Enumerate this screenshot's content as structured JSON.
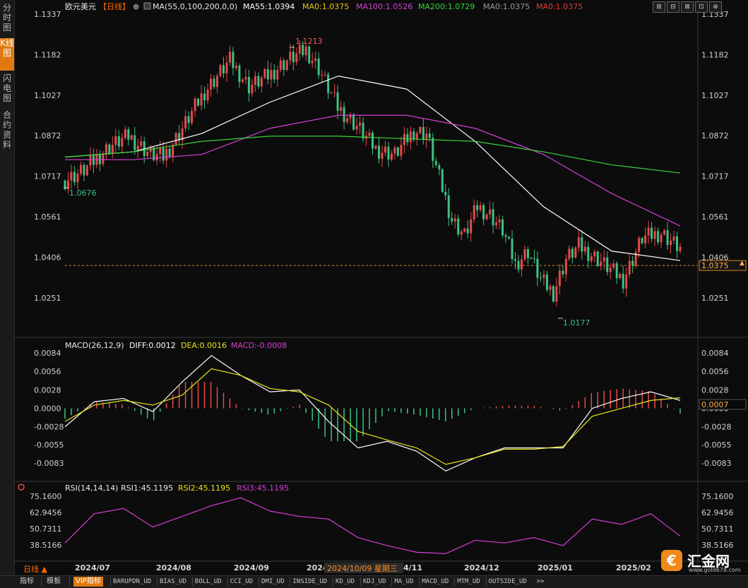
{
  "sidebar": {
    "tabs": [
      {
        "label": "分时图",
        "active": false
      },
      {
        "label": "K线图",
        "active": true
      },
      {
        "label": "闪电图",
        "active": false
      },
      {
        "label": "合约资料",
        "active": false
      }
    ]
  },
  "header": {
    "symbol": "欧元美元",
    "period_tag": "【日线】",
    "add_icon": "⊕",
    "ma_icon": "chart-settings-icon",
    "ma_params": "MA(55,0,100,200,0,0)",
    "items": [
      {
        "text": "MA55:1.0394",
        "color": "#ffffff"
      },
      {
        "text": "MA0:1.0375",
        "color": "#e6c619"
      },
      {
        "text": "MA100:1.0526",
        "color": "#d63ed6"
      },
      {
        "text": "MA200:1.0729",
        "color": "#3ad13a"
      },
      {
        "text": "MA0:1.0375",
        "color": "#9a9a9a"
      },
      {
        "text": "MA0:1.0375",
        "color": "#e03b3b"
      }
    ]
  },
  "window_buttons": [
    "⊞",
    "⊟",
    "⊠",
    "⊡",
    "⊗"
  ],
  "colors": {
    "up": "#e64a4a",
    "down": "#3cc285",
    "ma55": "#ffffff",
    "ma100": "#d63ed6",
    "ma200": "#3ad13a",
    "dea": "#e6e619",
    "rsi": "#d63ed6",
    "price_line": "#d98b1e"
  },
  "price_axis": {
    "ticks": [
      "1.1337",
      "1.1182",
      "1.1027",
      "1.0872",
      "1.0717",
      "1.0561",
      "1.0406",
      "1.0251"
    ],
    "current": "1.0375"
  },
  "annotations": {
    "high": "1.1213",
    "low_left": "1.0676",
    "low_right": "1.0177"
  },
  "macd": {
    "title": "MACD(26,12,9)",
    "diff": "DIFF:0.0012",
    "dea": "DEA:0.0016",
    "macd": "MACD:-0.0008",
    "ticks": [
      "0.0084",
      "0.0056",
      "0.0028",
      "0.0000",
      "-0.0028",
      "-0.0055",
      "-0.0083"
    ],
    "current": "0.0007"
  },
  "rsi": {
    "title": "RSI(14,14,14)",
    "rsi1": "RSI1:45.1195",
    "rsi2": "RSI2:45.1195",
    "rsi3": "RSI3:45.1195",
    "ticks": [
      "75.1600",
      "62.9456",
      "50.7311",
      "38.5166"
    ]
  },
  "time_axis": {
    "period_label": "日线 ▲",
    "labels": [
      "2024/07",
      "2024/08",
      "2024/09",
      "2024",
      "4/11",
      "2024/12",
      "2025/01",
      "2025/02"
    ],
    "cursor_date": "2024/10/09 星期三"
  },
  "bottom_bar": {
    "tabs": [
      "指标",
      "模板"
    ],
    "vip": "VIP指标",
    "indicators": [
      "BARUPDN_UD",
      "BIAS_UD",
      "BOLL_UD",
      "CCI_UD",
      "DMI_UD",
      "INSIDE_UD",
      "KD_UD",
      "KDJ_UD",
      "MA_UD",
      "MACD_UD",
      "MTM_UD",
      "OUTSIDE_UD"
    ],
    "more": ">>"
  },
  "logo": {
    "mark": "€",
    "text": "汇金网",
    "url": "www.gold678.com"
  },
  "chart_data": [
    {
      "type": "candlestick",
      "title": "欧元美元【日线】",
      "x": [
        "2024/07",
        "2024/08",
        "2024/09",
        "2024/10",
        "2024/11",
        "2024/12",
        "2025/01",
        "2025/02"
      ],
      "ylim": [
        1.018,
        1.1337
      ],
      "series": [
        {
          "name": "MA55",
          "values": [
            1.079,
            1.081,
            1.088,
            1.1,
            1.11,
            1.105,
            1.085,
            1.06,
            1.043,
            1.0394
          ]
        },
        {
          "name": "MA100",
          "values": [
            1.078,
            1.078,
            1.08,
            1.09,
            1.095,
            1.095,
            1.09,
            1.08,
            1.065,
            1.0526
          ]
        },
        {
          "name": "MA200",
          "values": [
            1.079,
            1.081,
            1.085,
            1.087,
            1.087,
            1.086,
            1.085,
            1.081,
            1.076,
            1.0729
          ]
        }
      ],
      "annotations": [
        {
          "text": "1.1213",
          "x": "2024/09/25",
          "y": 1.1213
        },
        {
          "text": "1.0676",
          "x": "2024/06/26",
          "y": 1.0676
        },
        {
          "text": "1.0177",
          "x": "2025/01/13",
          "y": 1.0177
        }
      ],
      "last_price": 1.0375
    },
    {
      "type": "bar",
      "title": "MACD(26,12,9)",
      "ylim": [
        -0.0083,
        0.0084
      ],
      "series": [
        {
          "name": "DIFF",
          "values": [
            -0.0028,
            0.001,
            0.0015,
            -0.0005,
            0.004,
            0.008,
            0.005,
            0.0025,
            0.0028,
            -0.002,
            -0.006,
            -0.005,
            -0.0065,
            -0.0095,
            -0.0075,
            -0.006,
            -0.006,
            -0.006,
            0.0,
            0.0015,
            0.0025,
            0.0012
          ]
        },
        {
          "name": "DEA",
          "values": [
            -0.002,
            0.0005,
            0.0012,
            0.0005,
            0.002,
            0.006,
            0.005,
            0.003,
            0.0025,
            0.0005,
            -0.0035,
            -0.0048,
            -0.006,
            -0.0085,
            -0.0075,
            -0.0062,
            -0.0062,
            -0.0058,
            -0.0012,
            0.0,
            0.0012,
            0.0016
          ]
        }
      ]
    },
    {
      "type": "line",
      "title": "RSI(14,14,14)",
      "ylim": [
        38.5166,
        75.16
      ],
      "series": [
        {
          "name": "RSI1",
          "values": [
            40,
            62,
            66,
            52,
            60,
            68,
            74,
            64,
            60,
            58,
            44,
            38,
            33,
            32,
            42,
            40,
            44,
            38,
            58,
            54,
            62,
            45.1195
          ]
        }
      ]
    }
  ]
}
